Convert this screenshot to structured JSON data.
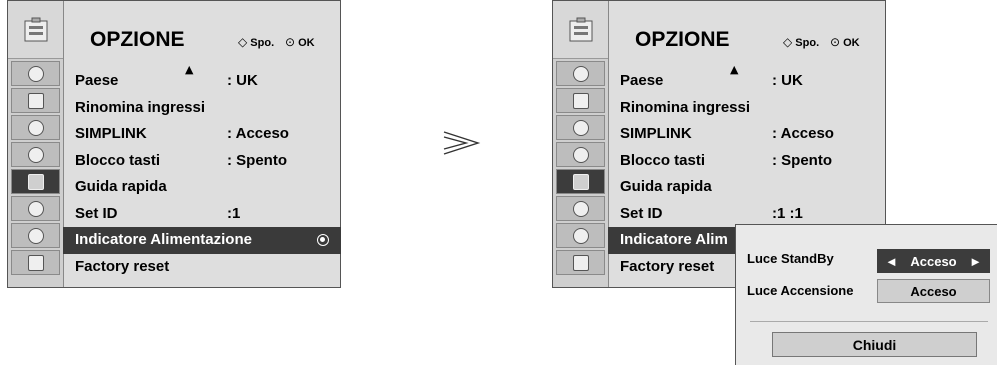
{
  "menu_title": "OPZIONE",
  "nav": {
    "move_glyph": "◇",
    "move_label": "Spo.",
    "ok_glyph": "⊙",
    "ok_label": "OK"
  },
  "scroll_up_glyph": "▲",
  "items": [
    {
      "label": "Paese",
      "value": ": UK"
    },
    {
      "label": "Rinomina ingressi",
      "value": ""
    },
    {
      "label": "SIMPLINK",
      "value": ": Acceso"
    },
    {
      "label": "Blocco tasti",
      "value": ": Spento"
    },
    {
      "label": "Guida rapida",
      "value": ""
    },
    {
      "label": "Set ID",
      "value": ":1"
    },
    {
      "label": "Indicatore Alimentazione",
      "value": ""
    },
    {
      "label": "Factory reset",
      "value": ""
    }
  ],
  "right_items": {
    "set_id_value": ":1   :1",
    "power_indicator_truncated": "Indicatore Alim"
  },
  "popup": {
    "standby_label": "Luce StandBy",
    "standby_value": "Acceso",
    "power_on_label": "Luce Accensione",
    "power_on_value": "Acceso",
    "close_label": "Chiudi",
    "arrow_left": "◄",
    "arrow_right": "►"
  },
  "colors": {
    "selected_row": "#3a3a3a",
    "panel_bg": "#dedede"
  }
}
